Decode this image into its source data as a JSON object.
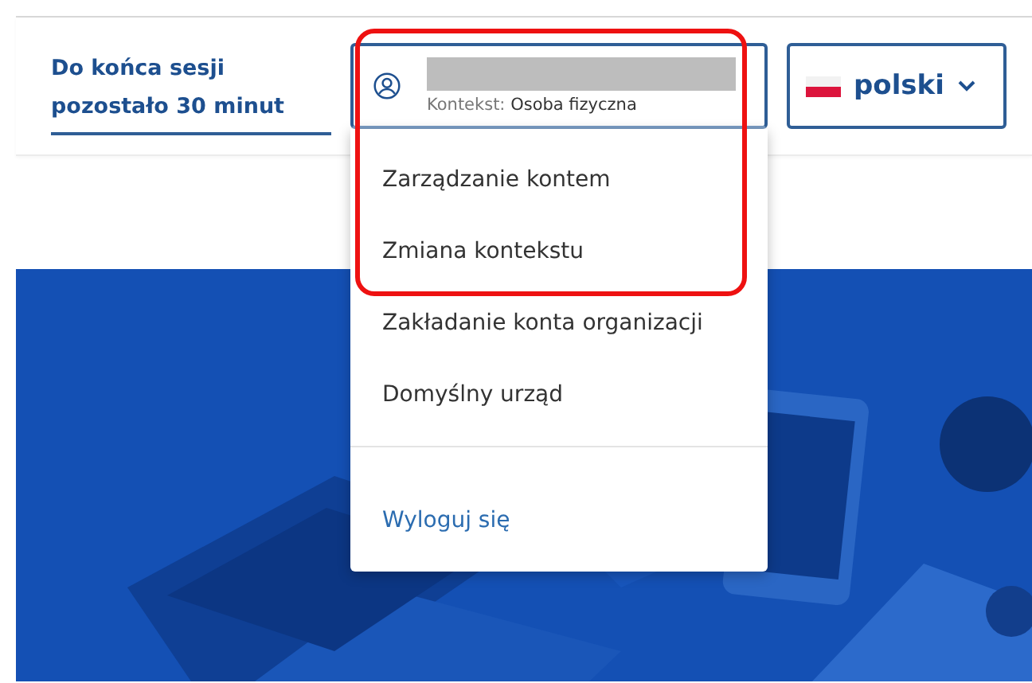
{
  "session_notice": {
    "line_1": "Do końca sesji",
    "line_2": "pozostało 30 minut"
  },
  "account": {
    "context_label": "Kontekst:",
    "context_value": "Osoba fizyczna",
    "expanded": true
  },
  "language": {
    "label": "polski"
  },
  "account_menu": [
    {
      "label": "Zarządzanie kontem",
      "kind": "item"
    },
    {
      "label": "Zmiana kontekstu",
      "kind": "item"
    },
    {
      "label": "Zakładanie konta organizacji",
      "kind": "item"
    },
    {
      "label": "Domyślny urząd",
      "kind": "item"
    },
    {
      "label": "Wyloguj się",
      "kind": "logout"
    }
  ]
}
